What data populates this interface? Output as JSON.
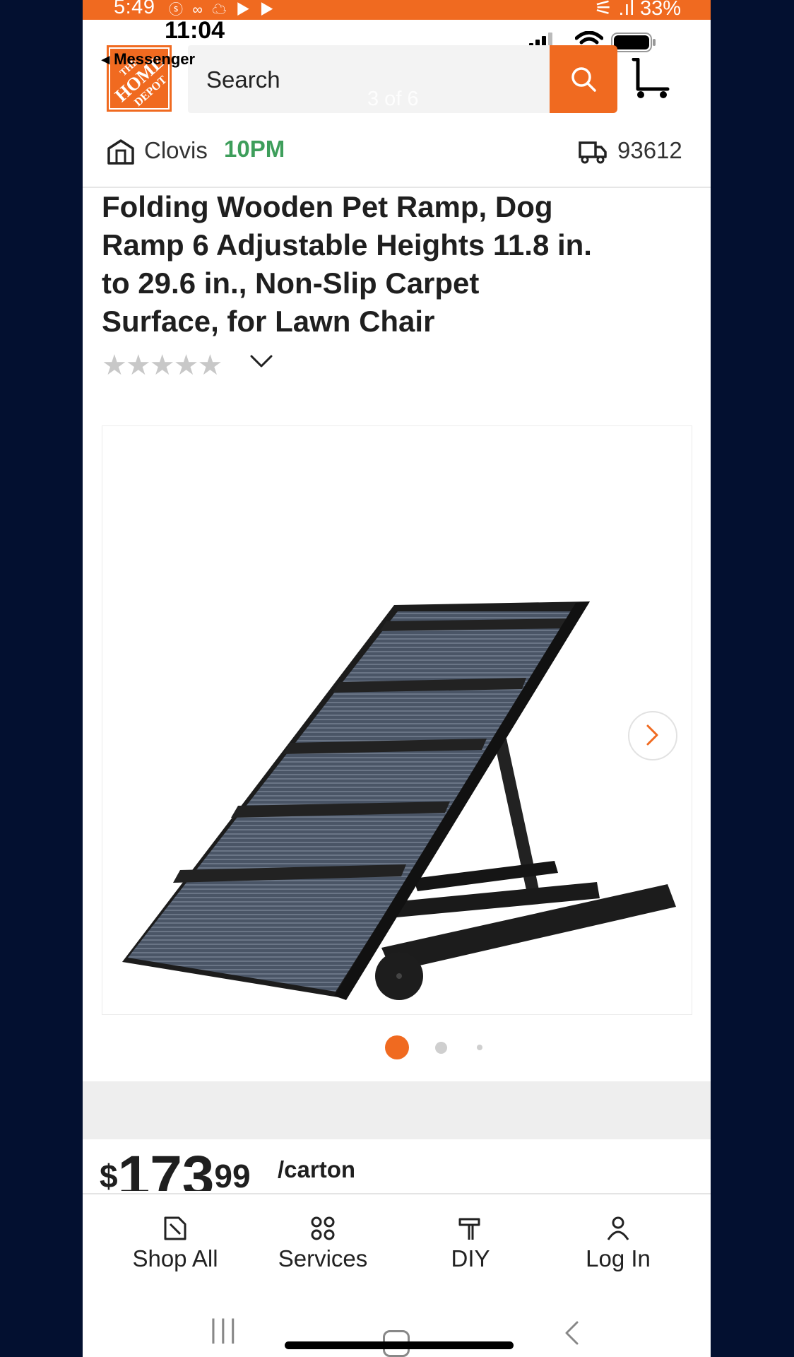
{
  "android_status": {
    "time": "5:49",
    "icons": "ⓢ ∞ ☁ ▶ ▶",
    "right": "⚟ .ıl 33%"
  },
  "ios_status": {
    "time": "11:04",
    "back_app": "◂ Messenger"
  },
  "header": {
    "logo_text": "THE HOME DEPOT",
    "search_placeholder": "Search",
    "image_counter": "3 of 6",
    "accent_color": "#f06a20"
  },
  "store": {
    "name": "Clovis",
    "hours": "10PM",
    "zip": "93612"
  },
  "product": {
    "title": "Folding Wooden Pet Ramp, Dog Ramp 6 Adjustable Heights 11.8 in. to 29.6 in., Non-Slip Carpet Surface, for Lawn Chair",
    "rating_stars": "★★★★★",
    "rating_value": 0,
    "image_index": 1,
    "image_total": 3
  },
  "price": {
    "currency": "$",
    "dollars": "173",
    "cents": "99",
    "unit": "/carton"
  },
  "nav": {
    "items": [
      {
        "label": "Shop All",
        "icon": "tag-icon"
      },
      {
        "label": "Services",
        "icon": "grid-icon"
      },
      {
        "label": "DIY",
        "icon": "hammer-icon"
      },
      {
        "label": "Log In",
        "icon": "user-icon"
      }
    ]
  },
  "system_nav": {
    "recent": "|||"
  }
}
